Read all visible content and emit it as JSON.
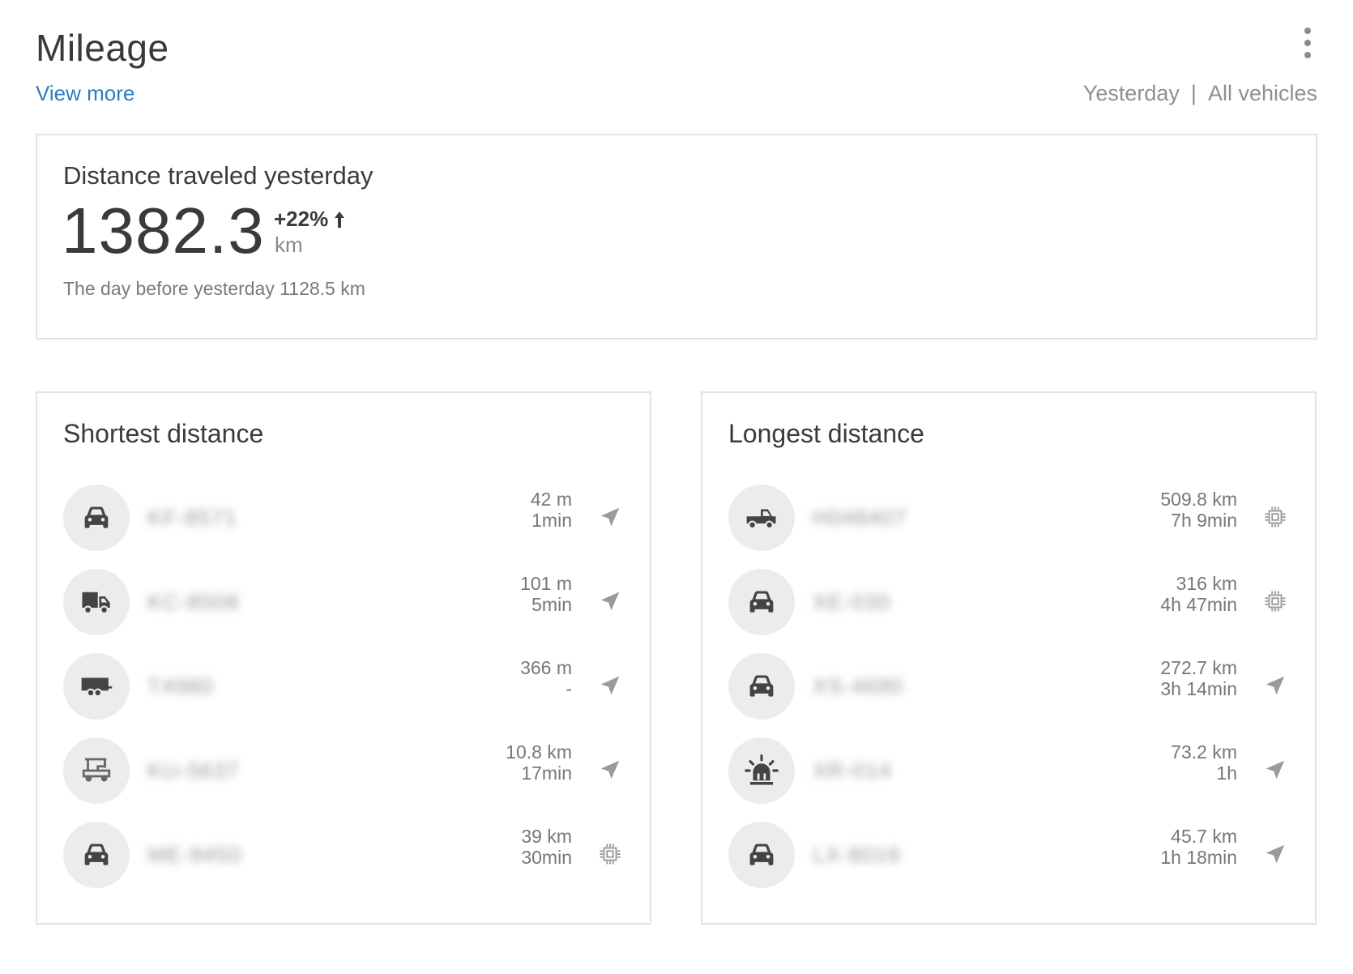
{
  "header": {
    "title": "Mileage",
    "view_more": "View more",
    "period_filter": "Yesterday",
    "separator": "|",
    "vehicle_filter": "All vehicles"
  },
  "summary": {
    "title": "Distance traveled yesterday",
    "value": "1382.3",
    "change": "+22%",
    "unit": "km",
    "previous": "The day before yesterday 1128.5 km"
  },
  "shortest": {
    "title": "Shortest distance",
    "rows": [
      {
        "plate": "KF-8571",
        "distance": "42 m",
        "duration": "1min",
        "vehicle_icon": "car-icon",
        "status_icon": "location-arrow-icon"
      },
      {
        "plate": "KC-8508",
        "distance": "101 m",
        "duration": "5min",
        "vehicle_icon": "truck-icon",
        "status_icon": "location-arrow-icon"
      },
      {
        "plate": "T4980",
        "distance": "366 m",
        "duration": "-",
        "vehicle_icon": "trailer-icon",
        "status_icon": "location-arrow-icon"
      },
      {
        "plate": "KU-5637",
        "distance": "10.8 km",
        "duration": "17min",
        "vehicle_icon": "golf-cart-icon",
        "status_icon": "location-arrow-icon"
      },
      {
        "plate": "ME-9450",
        "distance": "39 km",
        "duration": "30min",
        "vehicle_icon": "car-icon",
        "status_icon": "chip-icon"
      }
    ]
  },
  "longest": {
    "title": "Longest distance",
    "rows": [
      {
        "plate": "H048407",
        "distance": "509.8 km",
        "duration": "7h 9min",
        "vehicle_icon": "pickup-truck-icon",
        "status_icon": "chip-icon"
      },
      {
        "plate": "XE-030",
        "distance": "316 km",
        "duration": "4h 47min",
        "vehicle_icon": "car-icon",
        "status_icon": "chip-icon"
      },
      {
        "plate": "XS-4690",
        "distance": "272.7 km",
        "duration": "3h 14min",
        "vehicle_icon": "car-icon",
        "status_icon": "location-arrow-icon"
      },
      {
        "plate": "XR-014",
        "distance": "73.2 km",
        "duration": "1h",
        "vehicle_icon": "siren-icon",
        "status_icon": "location-arrow-icon"
      },
      {
        "plate": "LX-8016",
        "distance": "45.7 km",
        "duration": "1h 18min",
        "vehicle_icon": "car-icon",
        "status_icon": "location-arrow-icon"
      }
    ]
  }
}
